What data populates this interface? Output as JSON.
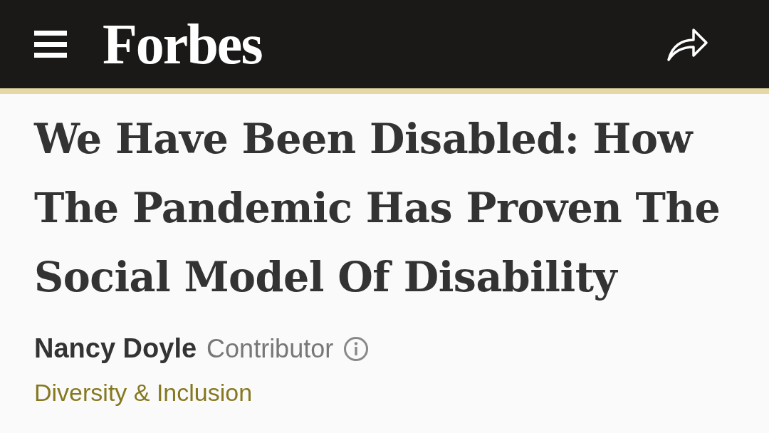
{
  "header": {
    "logo": "Forbes"
  },
  "article": {
    "title": "We Have Been Disabled: How The Pandemic Has Proven The Social Model Of Disability",
    "author": "Nancy Doyle",
    "role": "Contributor",
    "category": "Diversity & Inclusion"
  }
}
